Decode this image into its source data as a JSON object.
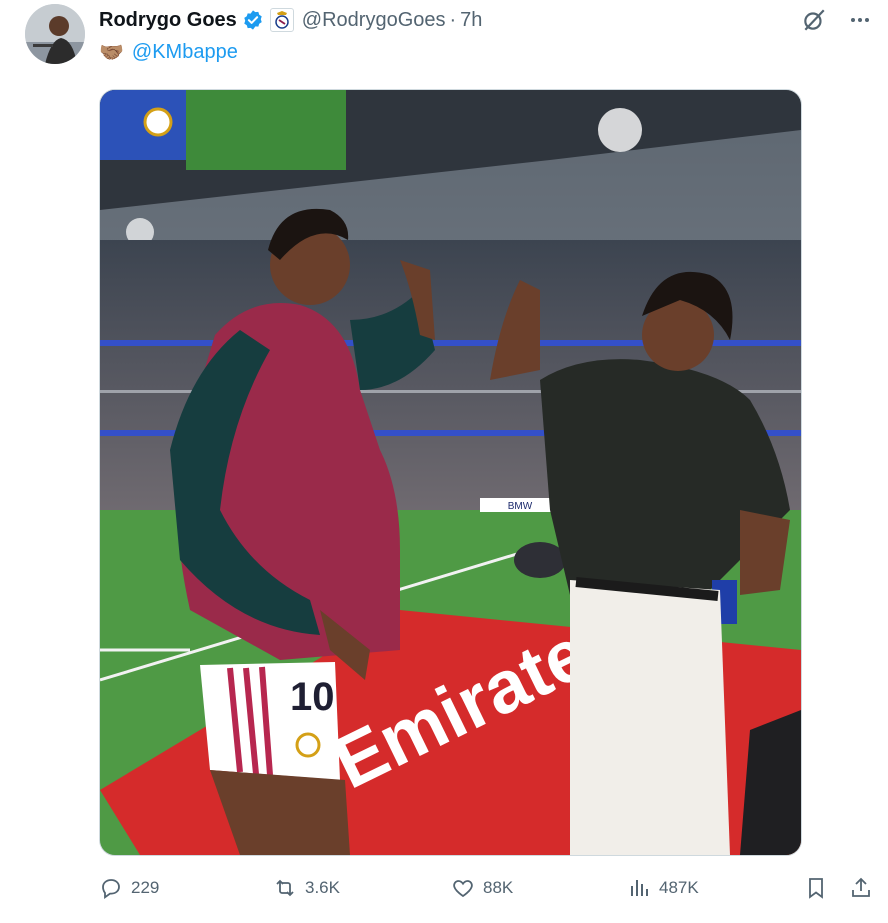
{
  "author": {
    "name": "Rodrygo Goes",
    "handle": "@RodrygoGoes",
    "separator": "·",
    "time": "7h"
  },
  "tweet": {
    "emoji": "🤝🏽",
    "mention": "@KMbappe"
  },
  "media": {
    "in_image_text": {
      "sponsor": "Emirates",
      "jersey_number": "10",
      "board": "BMW"
    }
  },
  "actions": {
    "replies": "229",
    "reposts": "3.6K",
    "likes": "88K",
    "views": "487K"
  },
  "colors": {
    "accent": "#1d9bf0",
    "muted": "#536471",
    "text": "#0f1419"
  }
}
